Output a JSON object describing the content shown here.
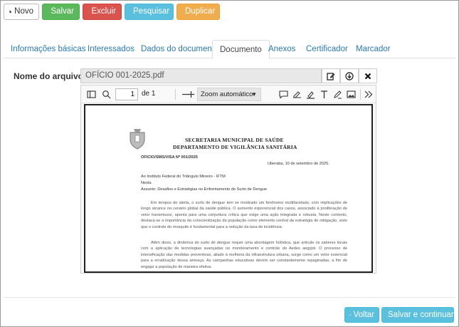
{
  "toolbar": {
    "novo": "Novo",
    "salvar": "Salvar",
    "excluir": "Excluir",
    "pesquisar": "Pesquisar",
    "duplicar": "Duplicar",
    "colors": {
      "salvar": "#5cb85c",
      "excluir": "#d9534f",
      "pesquisar": "#5bc0de",
      "duplicar": "#f0ad4e"
    }
  },
  "tabs": [
    {
      "label": "Informações básicas",
      "active": false
    },
    {
      "label": "Interessados",
      "active": false
    },
    {
      "label": "Dados do documento",
      "active": false
    },
    {
      "label": "Documento",
      "active": true
    },
    {
      "label": "Anexos",
      "active": false
    },
    {
      "label": "Certificador",
      "active": false
    },
    {
      "label": "Marcador",
      "active": false
    }
  ],
  "file": {
    "label": "Nome do arquivo",
    "value": "OFÍCIO 001-2025.pdf",
    "actions": [
      "edit-icon",
      "download-icon",
      "close-icon"
    ]
  },
  "viewer": {
    "page": "1",
    "page_total": "de 1",
    "zoom": "Zoom automático",
    "icons": [
      "sidebar-toggle-icon",
      "search-icon",
      "zoom-out-icon",
      "zoom-in-icon",
      "comment-icon",
      "signature-icon",
      "highlight-icon",
      "text-icon",
      "draw-icon",
      "image-icon",
      "more-tools-icon"
    ]
  },
  "document": {
    "header1": "SECRETARIA MUNICIPAL DE SAÚDE",
    "header2": "DEPARTAMENTO DE VIGILÂNCIA SANITÁRIA",
    "ref": "OFICIO/SMS/VISA Nº 001/2025",
    "date": "Uberaba, 10 de setembro de 2025.",
    "to1": "Ao Instituto Federal do Triângulo Mineiro - IFTM",
    "to2": "Nesta",
    "subject": "Assunto: Desafios e Estratégias no Enfrentamento do Surto de Dengue",
    "p1": "Em tempos de alerta, o surto de dengue tem se mostrado um fenômeno multifacetado, com implicações de longo alcance no cenário global da saúde pública. O aumento exponencial dos casos, associado à proliferação do vetor transmissor, aponta para uma conjuntura crítica que exige uma ação integrada e robusta. Neste contexto, destaca-se a importância da conscientização da população como elemento central da estratégia de mitigação, visto que o controle do mosquito é fundamental para a redução da taxa de incidência.",
    "p2": "Além disso, a dinâmica do surto de dengue requer uma abordagem holística, que articule os saberes locais com a aplicação de tecnologias avançadas no monitoramento e controle do Aedes aegypti. O processo de intensificação das medidas preventivas, aliado à melhoria da infraestrutura urbana, surge como um vetor essencial para a erradicação dessa ameaça. As campanhas educativas devem ser constantemente repaginadas, a fim de engajar a população de maneira efetiva."
  },
  "footer": {
    "voltar": "Voltar",
    "salvar_continuar": "Salvar e continuar"
  }
}
